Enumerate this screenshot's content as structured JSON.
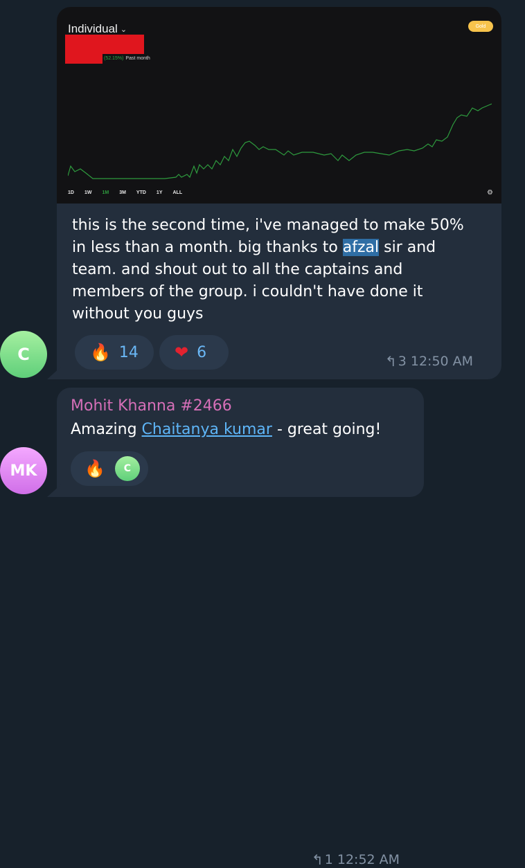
{
  "message1": {
    "avatar_initial": "C",
    "screenshot": {
      "account_label": "Individual",
      "percent_change": "(52.15%)",
      "period": "Past month",
      "badge": "Gold",
      "time_ranges": [
        "1D",
        "1W",
        "1M",
        "3M",
        "YTD",
        "1Y",
        "ALL"
      ],
      "active_range": "1M",
      "chart_color": "#2e9b3e",
      "redaction_color": "#e0161e"
    },
    "text_before": "this is the second time, i've managed to make 50% in less than a month. big thanks to ",
    "text_highlight": "afzal",
    "text_after": " sir and team. and shout out to all the captains and members of the group. i couldn't have done it without you guys",
    "reactions": [
      {
        "emoji": "🔥",
        "icon": "fire-icon",
        "count": "14"
      },
      {
        "emoji": "❤",
        "icon": "heart-icon",
        "count": "6"
      }
    ],
    "reply_count": "3",
    "time": "12:50 AM"
  },
  "message2": {
    "avatar_initials": "MK",
    "sender": "Mohit Khanna #2466",
    "text_before": "Amazing ",
    "mention": "Chaitanya kumar",
    "text_after": " - great going!",
    "reaction": {
      "emoji": "🔥",
      "icon": "fire-icon",
      "reactor_initial": "C"
    },
    "reply_count": "1",
    "time": "12:52 AM"
  },
  "colors": {
    "background": "#17212b",
    "bubble": "#232e3c",
    "accent_link": "#5eb5f7",
    "sender_name": "#d66fb8",
    "meta": "#8392a4"
  }
}
